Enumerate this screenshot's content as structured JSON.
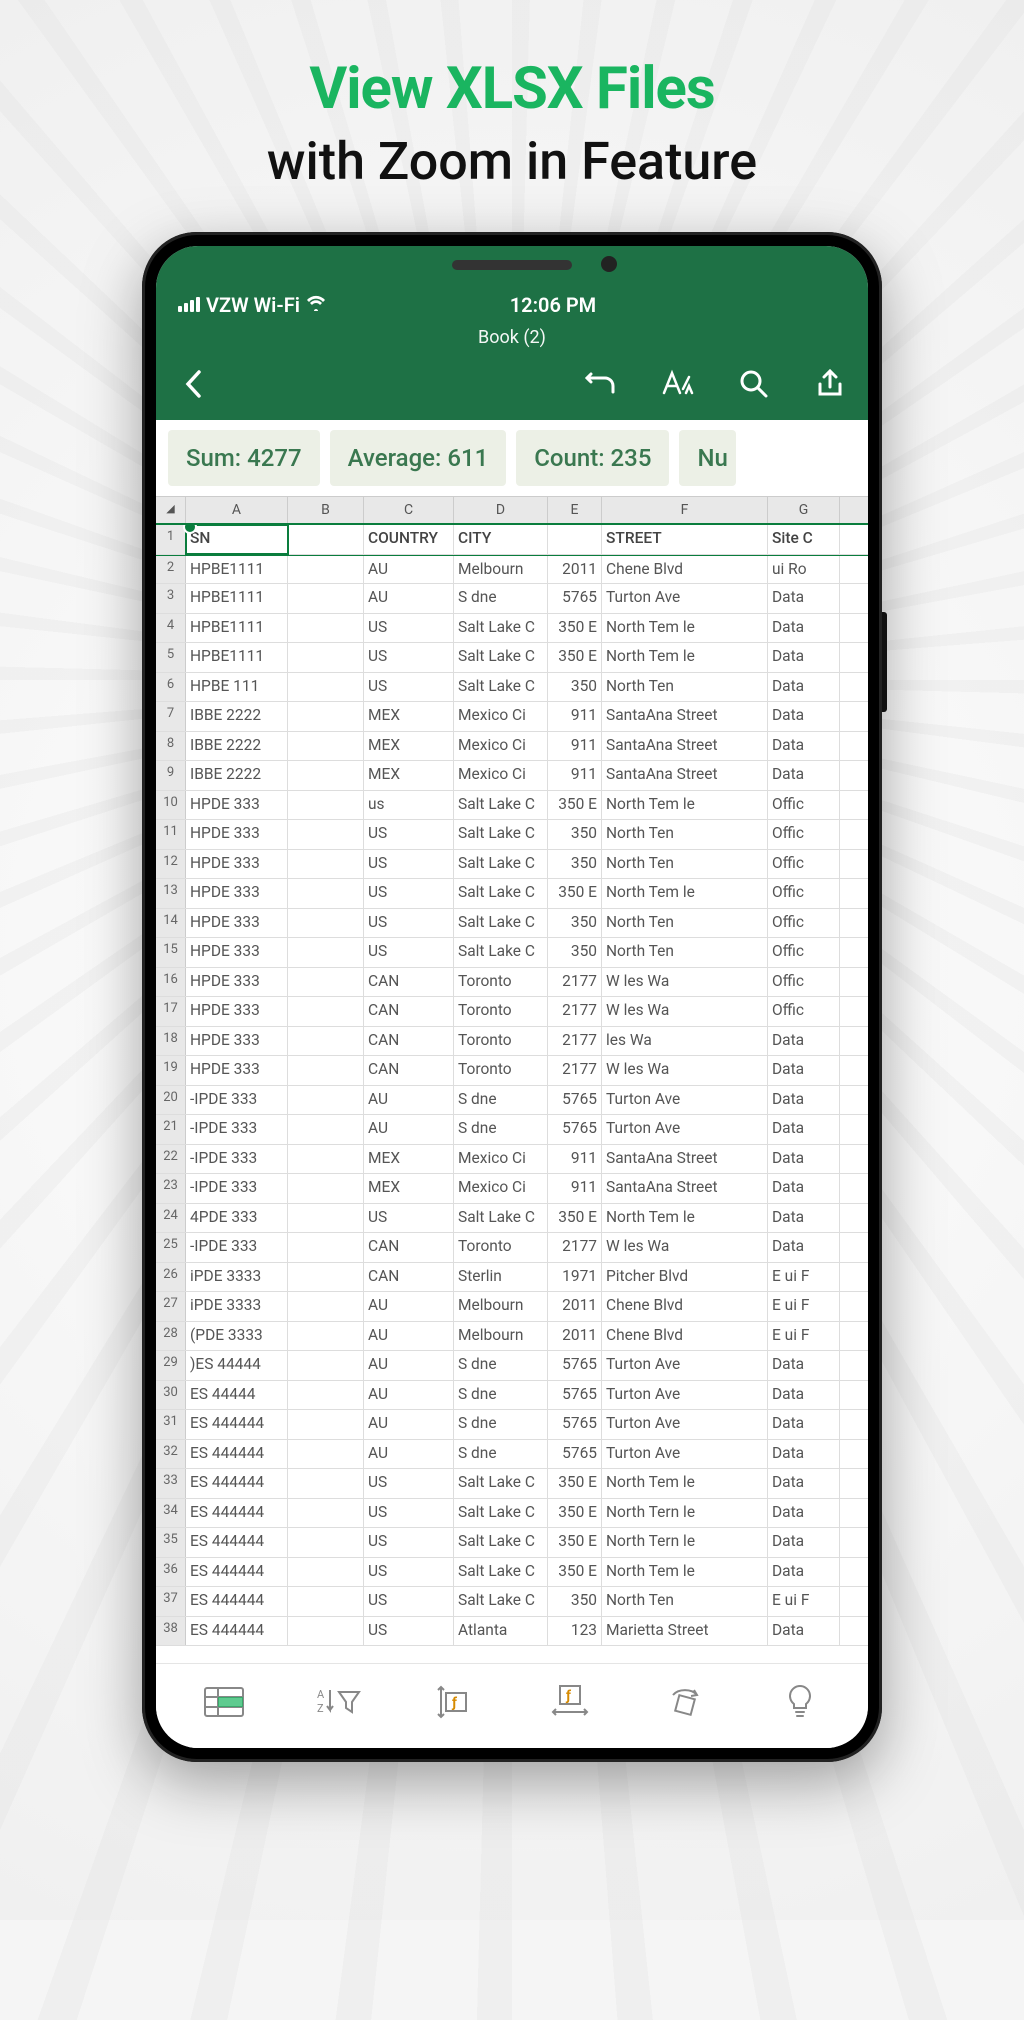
{
  "promo": {
    "title": "View XLSX Files",
    "subtitle": "with Zoom in Feature"
  },
  "status": {
    "carrier": "VZW Wi-Fi",
    "time": "12:06 PM"
  },
  "doc": {
    "title": "Book (2)"
  },
  "stats": {
    "sum": "Sum: 4277",
    "average": "Average: 611",
    "count": "Count: 235",
    "nu": "Nu"
  },
  "columns": [
    "A",
    "B",
    "C",
    "D",
    "E",
    "F",
    "G"
  ],
  "corner": "◢",
  "sheet_header": {
    "a": "SN",
    "c": "COUNTRY",
    "d": "CITY",
    "f": "STREET",
    "g": "Site C"
  },
  "rows": [
    {
      "n": "2",
      "a": "HPBE1111",
      "c": "AU",
      "d": "Melbourn",
      "e": "2011",
      "f": "Chene Blvd",
      "g": "ui Ro"
    },
    {
      "n": "3",
      "a": "HPBE1111",
      "c": "AU",
      "d": "S dne",
      "e": "5765",
      "f": "Turton Ave",
      "g": "Data"
    },
    {
      "n": "4",
      "a": "HPBE1111",
      "c": "US",
      "d": "Salt Lake C",
      "e": "350 E",
      "f": "North Tem le",
      "g": "Data"
    },
    {
      "n": "5",
      "a": "HPBE1111",
      "c": "US",
      "d": "Salt Lake C",
      "e": "350 E",
      "f": "North Tem le",
      "g": "Data"
    },
    {
      "n": "6",
      "a": "HPBE 111",
      "c": "US",
      "d": "Salt Lake C",
      "e": "350",
      "f": "North Ten",
      "g": "Data"
    },
    {
      "n": "7",
      "a": "IBBE 2222",
      "c": "MEX",
      "d": "Mexico Ci",
      "e": "911",
      "f": "SantaAna Street",
      "g": "Data"
    },
    {
      "n": "8",
      "a": "IBBE 2222",
      "c": "MEX",
      "d": "Mexico Ci",
      "e": "911",
      "f": "SantaAna Street",
      "g": "Data"
    },
    {
      "n": "9",
      "a": "IBBE 2222",
      "c": "MEX",
      "d": "Mexico Ci",
      "e": "911",
      "f": "SantaAna Street",
      "g": "Data"
    },
    {
      "n": "10",
      "a": "HPDE 333",
      "c": "us",
      "d": "Salt Lake C",
      "e": "350 E",
      "f": "North Tem le",
      "g": "Offic"
    },
    {
      "n": "11",
      "a": "HPDE 333",
      "c": "US",
      "d": "Salt Lake C",
      "e": "350",
      "f": "North Ten",
      "g": "Offic"
    },
    {
      "n": "12",
      "a": "HPDE 333",
      "c": "US",
      "d": "Salt Lake C",
      "e": "350",
      "f": "North Ten",
      "g": "Offic"
    },
    {
      "n": "13",
      "a": "HPDE 333",
      "c": "US",
      "d": "Salt Lake C",
      "e": "350 E",
      "f": "North Tem le",
      "g": "Offic"
    },
    {
      "n": "14",
      "a": "HPDE 333",
      "c": "US",
      "d": "Salt Lake C",
      "e": "350",
      "f": "North Ten",
      "g": "Offic"
    },
    {
      "n": "15",
      "a": "HPDE 333",
      "c": "US",
      "d": "Salt Lake C",
      "e": "350",
      "f": "North Ten",
      "g": "Offic"
    },
    {
      "n": "16",
      "a": "HPDE 333",
      "c": "CAN",
      "d": "Toronto",
      "e": "2177",
      "f": "W les Wa",
      "g": "Offic"
    },
    {
      "n": "17",
      "a": "HPDE 333",
      "c": "CAN",
      "d": "Toronto",
      "e": "2177",
      "f": "W les Wa",
      "g": "Offic"
    },
    {
      "n": "18",
      "a": "HPDE 333",
      "c": "CAN",
      "d": "Toronto",
      "e": "2177",
      "f": "les Wa",
      "g": "Data"
    },
    {
      "n": "19",
      "a": "HPDE 333",
      "c": "CAN",
      "d": "Toronto",
      "e": "2177",
      "f": "W les Wa",
      "g": "Data"
    },
    {
      "n": "20",
      "a": "-IPDE 333",
      "c": "AU",
      "d": "S dne",
      "e": "5765",
      "f": "Turton Ave",
      "g": "Data"
    },
    {
      "n": "21",
      "a": "-IPDE 333",
      "c": "AU",
      "d": "S dne",
      "e": "5765",
      "f": "Turton Ave",
      "g": "Data"
    },
    {
      "n": "22",
      "a": "-IPDE 333",
      "c": "MEX",
      "d": "Mexico Ci",
      "e": "911",
      "f": "SantaAna Street",
      "g": "Data"
    },
    {
      "n": "23",
      "a": "-IPDE 333",
      "c": "MEX",
      "d": "Mexico Ci",
      "e": "911",
      "f": "SantaAna Street",
      "g": "Data"
    },
    {
      "n": "24",
      "a": "4PDE 333",
      "c": "US",
      "d": "Salt Lake C",
      "e": "350 E",
      "f": "North Tem le",
      "g": "Data"
    },
    {
      "n": "25",
      "a": "-IPDE 333",
      "c": "CAN",
      "d": "Toronto",
      "e": "2177",
      "f": "W les Wa",
      "g": "Data"
    },
    {
      "n": "26",
      "a": "iPDE 3333",
      "c": "CAN",
      "d": "Sterlin",
      "e": "1971",
      "f": "Pitcher Blvd",
      "g": "E ui F"
    },
    {
      "n": "27",
      "a": "iPDE 3333",
      "c": "AU",
      "d": "Melbourn",
      "e": "2011",
      "f": "Chene Blvd",
      "g": "E ui F"
    },
    {
      "n": "28",
      "a": "(PDE 3333",
      "c": "AU",
      "d": "Melbourn",
      "e": "2011",
      "f": "Chene Blvd",
      "g": "E ui F"
    },
    {
      "n": "29",
      "a": ")ES 44444",
      "c": "AU",
      "d": "S dne",
      "e": "5765",
      "f": "Turton Ave",
      "g": "Data"
    },
    {
      "n": "30",
      "a": "ES 44444",
      "c": "AU",
      "d": "S dne",
      "e": "5765",
      "f": "Turton Ave",
      "g": "Data"
    },
    {
      "n": "31",
      "a": "ES 444444",
      "c": "AU",
      "d": "S dne",
      "e": "5765",
      "f": "Turton Ave",
      "g": "Data"
    },
    {
      "n": "32",
      "a": "ES 444444",
      "c": "AU",
      "d": "S dne",
      "e": "5765",
      "f": "Turton Ave",
      "g": "Data"
    },
    {
      "n": "33",
      "a": "ES 444444",
      "c": "US",
      "d": "Salt Lake C",
      "e": "350 E",
      "f": "North Tem le",
      "g": "Data"
    },
    {
      "n": "34",
      "a": "ES 444444",
      "c": "US",
      "d": "Salt Lake C",
      "e": "350 E",
      "f": "North Tern le",
      "g": "Data"
    },
    {
      "n": "35",
      "a": "ES 444444",
      "c": "US",
      "d": "Salt Lake C",
      "e": "350 E",
      "f": "North Tern le",
      "g": "Data"
    },
    {
      "n": "36",
      "a": "ES 444444",
      "c": "US",
      "d": "Salt Lake C",
      "e": "350 E",
      "f": "North Tem le",
      "g": "Data"
    },
    {
      "n": "37",
      "a": "ES 444444",
      "c": "US",
      "d": "Salt Lake C",
      "e": "350",
      "f": "North Ten",
      "g": "E ui F"
    },
    {
      "n": "38",
      "a": "ES 444444",
      "c": "US",
      "d": "Atlanta",
      "e": "123",
      "f": "Marietta Street",
      "g": "Data"
    }
  ],
  "row1_num": "1"
}
